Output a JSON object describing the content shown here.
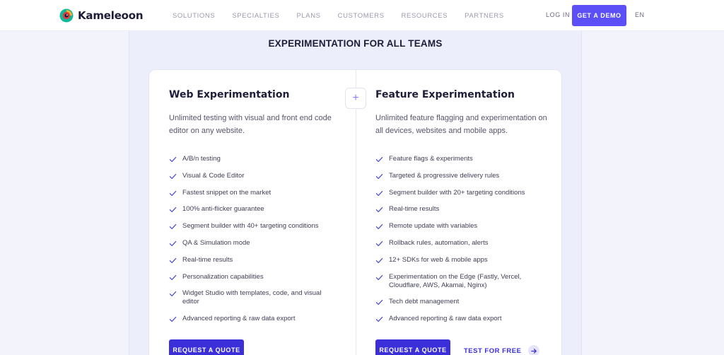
{
  "header": {
    "brand": "Kameleoon",
    "nav": [
      "SOLUTIONS",
      "SPECIALTIES",
      "PLANS",
      "CUSTOMERS",
      "RESOURCES",
      "PARTNERS"
    ],
    "login_label": "LOG IN",
    "demo_label": "GET A DEMO",
    "lang_label": "EN"
  },
  "section": {
    "title": "EXPERIMENTATION FOR ALL TEAMS",
    "divider_icon": "+"
  },
  "web": {
    "title": "Web Experimentation",
    "description": "Unlimited testing with visual and front end code editor on any website.",
    "features": [
      "A/B/n testing",
      "Visual & Code Editor",
      "Fastest snippet on the market",
      "100% anti-flicker guarantee",
      "Segment builder with 40+ targeting conditions",
      "QA & Simulation mode",
      "Real-time results",
      "Personalization capabilities",
      "Widget Studio with templates, code, and visual editor",
      "Advanced reporting & raw data export"
    ],
    "quote_label": "REQUEST A QUOTE"
  },
  "feature": {
    "title": "Feature Experimentation",
    "description": "Unlimited feature flagging and experimentation on all devices, websites and mobile apps.",
    "features": [
      "Feature flags & experiments",
      "Targeted & progressive delivery rules",
      "Segment builder with 20+ targeting conditions",
      "Real-time results",
      "Remote update with variables",
      "Rollback rules, automation, alerts",
      "12+ SDKs for web & mobile apps",
      "Experimentation on the Edge (Fastly, Vercel, Cloudflare, AWS, Akamai, Nginx)",
      "Tech debt management",
      "Advanced reporting & raw data export"
    ],
    "quote_label": "REQUEST A QUOTE",
    "test_label": "TEST FOR FREE"
  },
  "colors": {
    "accent": "#5b4ff5",
    "button": "#3b2fd9",
    "check": "#4a4ad0"
  },
  "icons": {
    "logo": "kameleoon-logo-icon",
    "check": "check-icon",
    "plus": "plus-icon",
    "arrow": "arrow-right-icon"
  }
}
